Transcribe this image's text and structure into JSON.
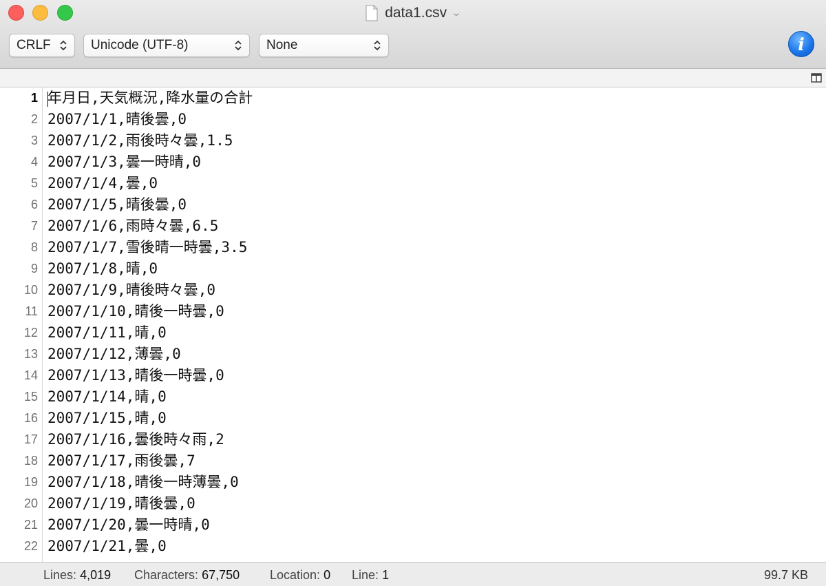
{
  "window": {
    "title": "data1.csv",
    "title_chevron": "⌄"
  },
  "toolbar": {
    "line_ending": "CRLF",
    "encoding": "Unicode (UTF-8)",
    "syntax": "None"
  },
  "editor": {
    "current_line": 1,
    "lines": [
      {
        "num": "1",
        "text": "年月日,天気概況,降水量の合計"
      },
      {
        "num": "2",
        "text": "2007/1/1,晴後曇,0"
      },
      {
        "num": "3",
        "text": "2007/1/2,雨後時々曇,1.5"
      },
      {
        "num": "4",
        "text": "2007/1/3,曇一時晴,0"
      },
      {
        "num": "5",
        "text": "2007/1/4,曇,0"
      },
      {
        "num": "6",
        "text": "2007/1/5,晴後曇,0"
      },
      {
        "num": "7",
        "text": "2007/1/6,雨時々曇,6.5"
      },
      {
        "num": "8",
        "text": "2007/1/7,雪後晴一時曇,3.5"
      },
      {
        "num": "9",
        "text": "2007/1/8,晴,0"
      },
      {
        "num": "10",
        "text": "2007/1/9,晴後時々曇,0"
      },
      {
        "num": "11",
        "text": "2007/1/10,晴後一時曇,0"
      },
      {
        "num": "12",
        "text": "2007/1/11,晴,0"
      },
      {
        "num": "13",
        "text": "2007/1/12,薄曇,0"
      },
      {
        "num": "14",
        "text": "2007/1/13,晴後一時曇,0"
      },
      {
        "num": "15",
        "text": "2007/1/14,晴,0"
      },
      {
        "num": "16",
        "text": "2007/1/15,晴,0"
      },
      {
        "num": "17",
        "text": "2007/1/16,曇後時々雨,2"
      },
      {
        "num": "18",
        "text": "2007/1/17,雨後曇,7"
      },
      {
        "num": "19",
        "text": "2007/1/18,晴後一時薄曇,0"
      },
      {
        "num": "20",
        "text": "2007/1/19,晴後曇,0"
      },
      {
        "num": "21",
        "text": "2007/1/20,曇一時晴,0"
      },
      {
        "num": "22",
        "text": "2007/1/21,曇,0"
      }
    ]
  },
  "status": {
    "lines_label": "Lines:",
    "lines_value": "4,019",
    "chars_label": "Characters:",
    "chars_value": "67,750",
    "location_label": "Location:",
    "location_value": "0",
    "line_label": "Line:",
    "line_value": "1",
    "file_size": "99.7 KB"
  },
  "colors": {
    "close": "#fc605c",
    "minimize": "#fdbc40",
    "maximize": "#34c84a",
    "info": "#1a73e8"
  },
  "icons": [
    "document-icon",
    "chevron-down-icon",
    "updown-arrows-icon",
    "info-icon",
    "split-view-icon"
  ]
}
